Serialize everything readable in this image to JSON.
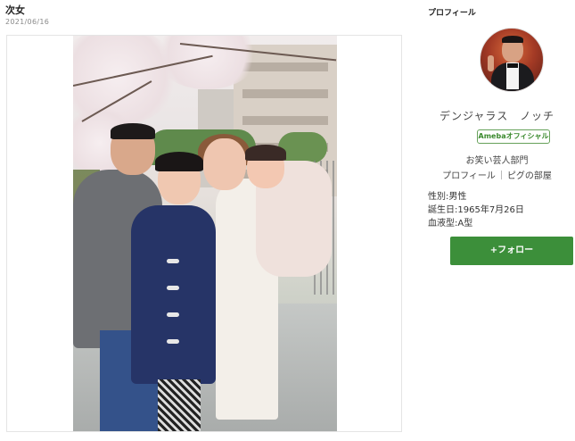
{
  "post": {
    "title": "次女",
    "date": "2021/06/16"
  },
  "profile": {
    "heading": "プロフィール",
    "display_name": "デンジャラス　ノッチ",
    "badge": "Amebaオフィシャル",
    "category": "お笑い芸人部門",
    "links": [
      "プロフィール",
      "ピグの部屋"
    ],
    "info": {
      "gender": "性別:男性",
      "birthday": "誕生日:1965年7月26日",
      "blood_type": "血液型:A型"
    },
    "follow_label": "+フォロー"
  },
  "colors": {
    "accent_green": "#3c8f3a",
    "badge_green": "#3b8a2e"
  }
}
